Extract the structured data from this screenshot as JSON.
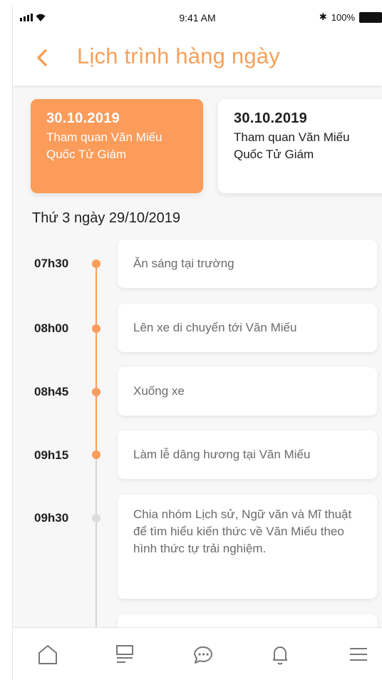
{
  "status_bar": {
    "time": "9:41 AM",
    "battery_text": "100%",
    "bluetooth_glyph": "✱"
  },
  "header": {
    "title": "Lịch trình hàng ngày",
    "back_icon": "chevron-left-icon"
  },
  "event_cards": [
    {
      "date": "30.10.2019",
      "description": "Tham quan Văn Miếu Quốc Tử Giám",
      "selected": true
    },
    {
      "date": "30.10.2019",
      "description": "Tham quan Văn Miếu Quốc Tử Giám",
      "selected": false
    }
  ],
  "schedule": {
    "day_heading": "Thứ 3 ngày 29/10/2019",
    "items": [
      {
        "time": "07h30",
        "text": "Ăn sáng tại trường",
        "status": "done"
      },
      {
        "time": "08h00",
        "text": "Lên xe di chuyển tới Văn Miếu",
        "status": "done"
      },
      {
        "time": "08h45",
        "text": "Xuống xe",
        "status": "done"
      },
      {
        "time": "09h15",
        "text": "Làm lễ dâng hương tại Văn Miếu",
        "status": "done"
      },
      {
        "time": "09h30",
        "text": "Chia nhóm Lịch sử, Ngữ văn và Mĩ thuật để tìm hiểu kiến thức về Văn Miếu theo hình thức tự trải nghiệm.",
        "status": "pending"
      }
    ]
  },
  "bottom_nav": [
    "home-icon",
    "schedule-icon",
    "chat-icon",
    "notification-icon",
    "menu-icon"
  ],
  "colors": {
    "accent": "#fb9c5a",
    "title": "#f7a05a",
    "pending": "#dddddd",
    "text_muted": "#6b6b6b"
  }
}
